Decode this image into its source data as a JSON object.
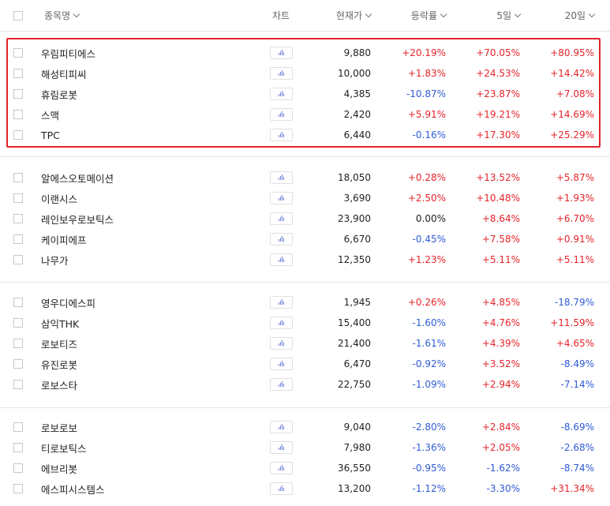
{
  "header": {
    "name_label": "종목명",
    "chart_label": "차트",
    "price_label": "현재가",
    "change_label": "등락률",
    "d5_label": "5일",
    "d20_label": "20일"
  },
  "colors": {
    "up": "#e5242b",
    "down": "#2f5bd6",
    "highlight": "#e0252b",
    "chart_icon": "#6b7fd7"
  },
  "groups": [
    {
      "highlighted": true,
      "rows": [
        {
          "name": "우림피티에스",
          "price": "9,880",
          "change": "+20.19%",
          "d5": "+70.05%",
          "d20": "+80.95%"
        },
        {
          "name": "해성티피씨",
          "price": "10,000",
          "change": "+1.83%",
          "d5": "+24.53%",
          "d20": "+14.42%"
        },
        {
          "name": "휴림로봇",
          "price": "4,385",
          "change": "-10.87%",
          "d5": "+23.87%",
          "d20": "+7.08%"
        },
        {
          "name": "스맥",
          "price": "2,420",
          "change": "+5.91%",
          "d5": "+19.21%",
          "d20": "+14.69%"
        },
        {
          "name": "TPC",
          "price": "6,440",
          "change": "-0.16%",
          "d5": "+17.30%",
          "d20": "+25.29%"
        }
      ]
    },
    {
      "highlighted": false,
      "rows": [
        {
          "name": "알에스오토메이션",
          "price": "18,050",
          "change": "+0.28%",
          "d5": "+13.52%",
          "d20": "+5.87%"
        },
        {
          "name": "이랜시스",
          "price": "3,690",
          "change": "+2.50%",
          "d5": "+10.48%",
          "d20": "+1.93%"
        },
        {
          "name": "레인보우로보틱스",
          "price": "23,900",
          "change": "0.00%",
          "d5": "+8.64%",
          "d20": "+6.70%"
        },
        {
          "name": "케이피에프",
          "price": "6,670",
          "change": "-0.45%",
          "d5": "+7.58%",
          "d20": "+0.91%"
        },
        {
          "name": "나무가",
          "price": "12,350",
          "change": "+1.23%",
          "d5": "+5.11%",
          "d20": "+5.11%"
        }
      ]
    },
    {
      "highlighted": false,
      "rows": [
        {
          "name": "영우디에스피",
          "price": "1,945",
          "change": "+0.26%",
          "d5": "+4.85%",
          "d20": "-18.79%"
        },
        {
          "name": "삼익THK",
          "price": "15,400",
          "change": "-1.60%",
          "d5": "+4.76%",
          "d20": "+11.59%"
        },
        {
          "name": "로보티즈",
          "price": "21,400",
          "change": "-1.61%",
          "d5": "+4.39%",
          "d20": "+4.65%"
        },
        {
          "name": "유진로봇",
          "price": "6,470",
          "change": "-0.92%",
          "d5": "+3.52%",
          "d20": "-8.49%"
        },
        {
          "name": "로보스타",
          "price": "22,750",
          "change": "-1.09%",
          "d5": "+2.94%",
          "d20": "-7.14%"
        }
      ]
    },
    {
      "highlighted": false,
      "rows": [
        {
          "name": "로보로보",
          "price": "9,040",
          "change": "-2.80%",
          "d5": "+2.84%",
          "d20": "-8.69%"
        },
        {
          "name": "티로보틱스",
          "price": "7,980",
          "change": "-1.36%",
          "d5": "+2.05%",
          "d20": "-2.68%"
        },
        {
          "name": "에브리봇",
          "price": "36,550",
          "change": "-0.95%",
          "d5": "-1.62%",
          "d20": "-8.74%"
        },
        {
          "name": "에스피시스템스",
          "price": "13,200",
          "change": "-1.12%",
          "d5": "-3.30%",
          "d20": "+31.34%"
        }
      ]
    }
  ]
}
